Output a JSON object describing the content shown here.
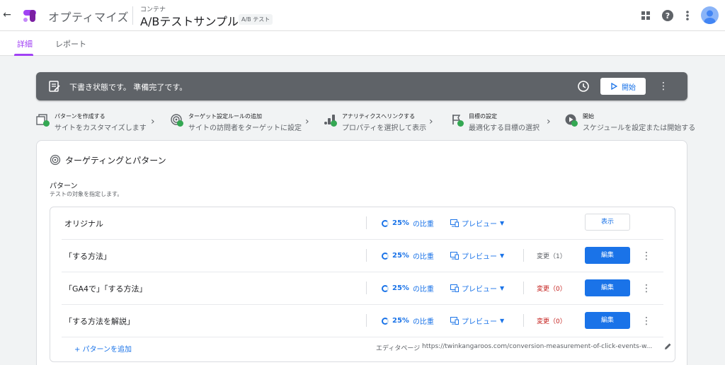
{
  "header": {
    "back_icon": "arrow-back-icon",
    "app_name": "オプティマイズ",
    "container_label": "コンテナ",
    "experiment_title": "A/Bテストサンプル",
    "experiment_type_badge": "A/B テスト",
    "icons": [
      "apps-icon",
      "help-icon",
      "more-vert-icon",
      "account-avatar"
    ]
  },
  "tabs": [
    {
      "label": "詳細",
      "active": true
    },
    {
      "label": "レポート",
      "active": false
    }
  ],
  "status_bar": {
    "text": "下書き状態です。 準備完了です。",
    "start_label": "開始",
    "colors": {
      "background": "#5f6368",
      "accent": "#1a73e8"
    }
  },
  "steps": [
    {
      "title": "パターンを作成する",
      "subtitle": "サイトをカスタマイズします",
      "icon": "pages-icon"
    },
    {
      "title": "ターゲット設定ルールの追加",
      "subtitle": "サイトの訪問者をターゲットに設定",
      "icon": "target-icon"
    },
    {
      "title": "アナリティクスへリンクする",
      "subtitle": "プロパティを選択して表示",
      "icon": "analytics-icon"
    },
    {
      "title": "目標の設定",
      "subtitle": "最適化する目標の選択",
      "icon": "flag-icon"
    },
    {
      "title": "開始",
      "subtitle": "スケジュールを設定または開始する",
      "icon": "play-icon"
    }
  ],
  "targeting": {
    "card_title": "ターゲティングとパターン",
    "section_title": "パターン",
    "section_subtitle": "テストの対象を指定します。",
    "variants": [
      {
        "name": "オリジナル",
        "weight": "25%",
        "weight_suffix": "の比重",
        "preview": "プレビュー",
        "changes": "",
        "action": "表示"
      },
      {
        "name": "「する方法」",
        "weight": "25%",
        "weight_suffix": "の比重",
        "preview": "プレビュー",
        "changes": "変更（1）",
        "action": "編集"
      },
      {
        "name": "「GA4で」「する方法」",
        "weight": "25%",
        "weight_suffix": "の比重",
        "preview": "プレビュー",
        "changes": "変更（0）",
        "action": "編集"
      },
      {
        "name": "「する方法を解説」",
        "weight": "25%",
        "weight_suffix": "の比重",
        "preview": "プレビュー",
        "changes": "変更（0）",
        "action": "編集"
      }
    ],
    "add_variant": "+ パターンを追加",
    "editor_page_label": "エディタページ",
    "editor_page_url": "https://twinkangaroos.com/conversion-measurement-of-click-events-w..."
  }
}
